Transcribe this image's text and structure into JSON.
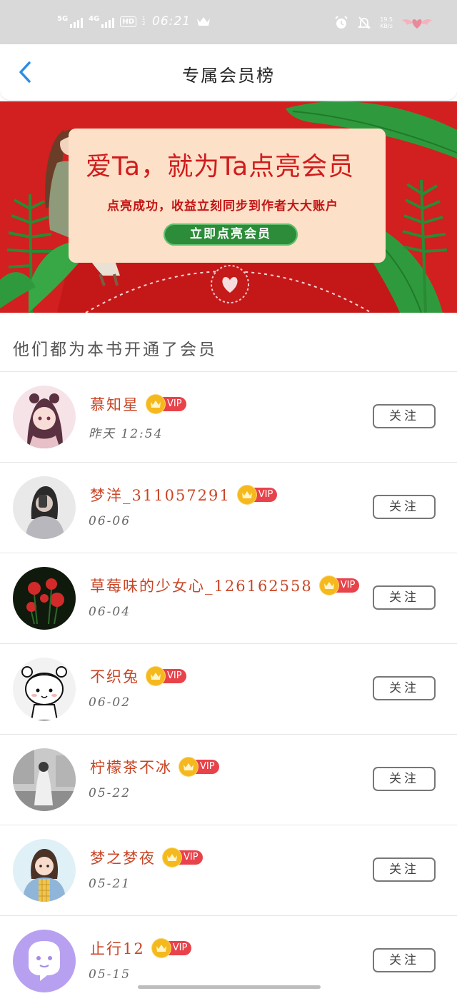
{
  "status_bar": {
    "sim1": "5G",
    "sim2": "4G",
    "hd": "HD",
    "hd_sub": "1 2",
    "time": "06:21",
    "speed_value": "19.5",
    "speed_unit": "KB/s"
  },
  "header": {
    "title": "专属会员榜"
  },
  "banner": {
    "headline": "爱Ta，就为Ta点亮会员",
    "subtitle": "点亮成功，收益立刻同步到作者大大账户",
    "button_label": "立即点亮会员"
  },
  "section_title": "他们都为本书开通了会员",
  "members": [
    {
      "name": "慕知星",
      "vip": "VIP",
      "date": "昨天 12:54",
      "follow": "关注"
    },
    {
      "name": "梦洋_311057291",
      "vip": "VIP",
      "date": "06-06",
      "follow": "关注"
    },
    {
      "name": "草莓味的少女心_126162558",
      "vip": "VIP",
      "date": "06-04",
      "follow": "关注"
    },
    {
      "name": "不织兔",
      "vip": "VIP",
      "date": "06-02",
      "follow": "关注"
    },
    {
      "name": "柠檬茶不冰",
      "vip": "VIP",
      "date": "05-22",
      "follow": "关注"
    },
    {
      "name": "梦之梦夜",
      "vip": "VIP",
      "date": "05-21",
      "follow": "关注"
    },
    {
      "name": "止行12",
      "vip": "VIP",
      "date": "05-15",
      "follow": "关注"
    }
  ],
  "colors": {
    "accent_blue": "#2b8ce8",
    "banner_red": "#d21f1f",
    "name_red": "#c94526",
    "vip_red": "#e8424b",
    "crown_gold": "#f5b91e"
  }
}
